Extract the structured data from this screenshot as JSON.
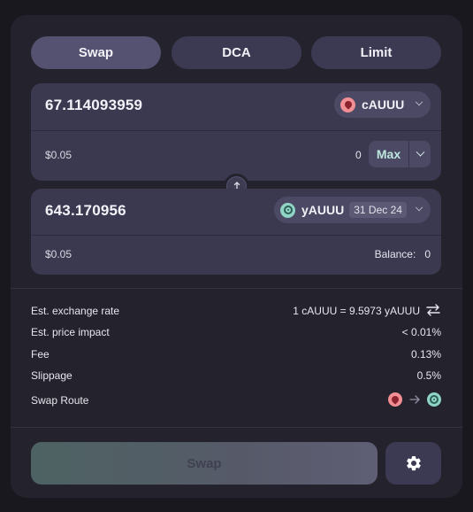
{
  "tabs": [
    {
      "label": "Swap",
      "active": true
    },
    {
      "label": "DCA",
      "active": false
    },
    {
      "label": "Limit",
      "active": false
    }
  ],
  "from": {
    "amount": "67.114093959",
    "usd": "$0.05",
    "token": "cAUUU",
    "token_icon": "red-token-icon",
    "balance": "0",
    "max_label": "Max"
  },
  "to": {
    "amount": "643.170956",
    "usd": "$0.05",
    "token": "yAUUU",
    "token_icon": "teal-token-icon",
    "maturity": "31 Dec 24",
    "balance_label": "Balance:",
    "balance": "0"
  },
  "info": {
    "rate_label": "Est. exchange rate",
    "rate_value": "1 cAUUU = 9.5973 yAUUU",
    "impact_label": "Est. price impact",
    "impact_value": "< 0.01%",
    "fee_label": "Fee",
    "fee_value": "0.13%",
    "slippage_label": "Slippage",
    "slippage_value": "0.5%",
    "route_label": "Swap Route"
  },
  "actions": {
    "swap_label": "Swap",
    "settings_icon": "gear-icon"
  },
  "colors": {
    "background": "#19181f",
    "card": "#24232d",
    "panel": "#3a3950",
    "accent": "#bde7df",
    "token_red": "#f28f94",
    "token_teal": "#8fd4c4"
  }
}
